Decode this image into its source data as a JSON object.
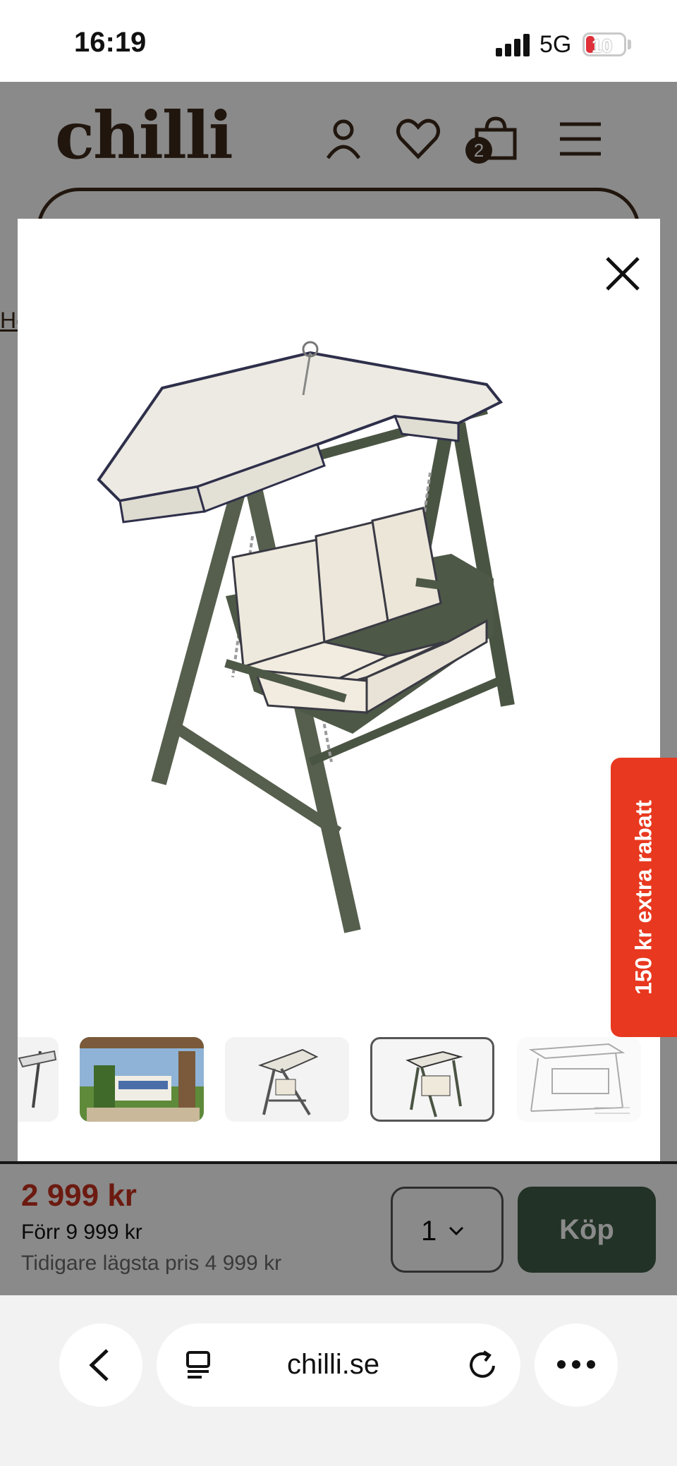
{
  "status_bar": {
    "time": "16:19",
    "network": "5G",
    "battery": "10"
  },
  "header": {
    "logo": "chilli",
    "cart_count": "2"
  },
  "breadcrumb": {
    "partial": "He"
  },
  "promo": {
    "label": "150 kr extra rabatt"
  },
  "price_bar": {
    "price": "2 999 kr",
    "previous_price": "Förr 9 999 kr",
    "lowest_price": "Tidigare lägsta pris 4 999 kr",
    "quantity": "1",
    "buy_label": "Köp"
  },
  "browser": {
    "url": "chilli.se"
  },
  "gallery": {
    "active_thumbnail_index": 3,
    "thumbnail_count": 5
  }
}
